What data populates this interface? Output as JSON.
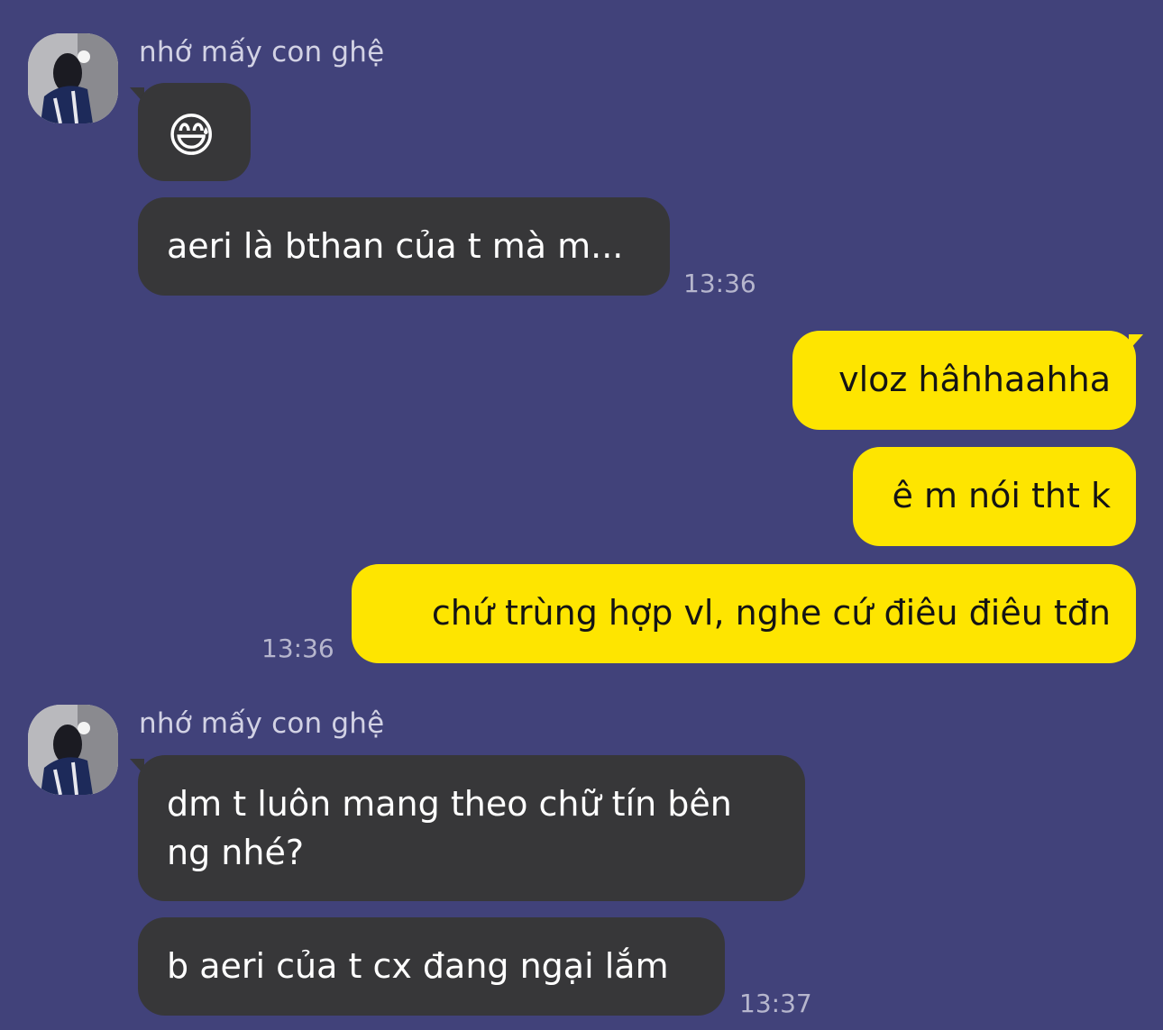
{
  "messages": [
    {
      "group_sender": "nhớ mấy con ghệ",
      "emoji": "😅",
      "text_1": "aeri là bthan của t mà m...",
      "time": "13:36"
    },
    {
      "out_1": "vloz hâhhaahha",
      "out_2": "ê m nói tht k",
      "out_3": "chứ trùng hợp vl, nghe cứ điêu điêu tđn",
      "time": "13:36"
    },
    {
      "group_sender": "nhớ mấy con ghệ",
      "text_1_line_1": "dm t luôn mang theo chữ tín bên",
      "text_1_line_2": "ng nhé?",
      "text_2": "b aeri của t cx đang ngại lắm",
      "time": "13:37"
    }
  ],
  "colors": {
    "background": "#41427a",
    "incoming_bubble": "#373739",
    "outgoing_bubble": "#fee500",
    "timestamp": "#b6b6cd",
    "sender_name": "#d2d2e4"
  }
}
